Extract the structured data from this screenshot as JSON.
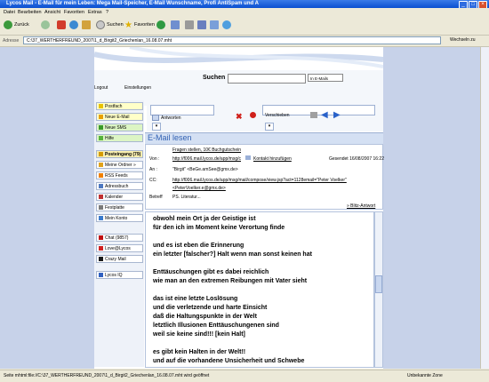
{
  "window": {
    "title": "Lycos Mail - E-Mail für mein Leben: Mega Mail-Speicher, E-Mail Wunschname, Profi AntiSpam und A"
  },
  "menu": [
    "Datei",
    "Bearbeiten",
    "Ansicht",
    "Favoriten",
    "Extras",
    "?"
  ],
  "toolbar": {
    "back": "Zurück",
    "search": "Suchen",
    "favorites": "Favoriten"
  },
  "address": {
    "label": "Adresse",
    "value": "C:\\37_WERTHERFREUND_2007\\1_d_Birgit2_Griechenlan_16.08.07.mht",
    "go": "Wechseln zu"
  },
  "header": {
    "search_label": "Suchen",
    "select_value": "In E-Mails",
    "logout": "Logout",
    "settings": "Einstellungen"
  },
  "sidebar": [
    {
      "label": "Postfach",
      "style": "y",
      "icon": "#e8c200"
    },
    {
      "label": "Neue E-Mail",
      "style": "y",
      "icon": "#e8a000"
    },
    {
      "label": "Neue SMS",
      "style": "g",
      "icon": "#3a9a2a"
    },
    {
      "label": "Hilfe",
      "style": "g",
      "icon": "#57b33c"
    },
    {
      "label": "Posteingang (79)",
      "style": "s",
      "icon": "#d49b00"
    },
    {
      "label": "Meine Ordner »",
      "style": "n",
      "icon": "#e0a21b"
    },
    {
      "label": "RSS Feeds",
      "style": "n",
      "icon": "#f08000"
    },
    {
      "label": "Adressbuch",
      "style": "n",
      "icon": "#4d78c0"
    },
    {
      "label": "Kalender",
      "style": "n",
      "icon": "#c03030"
    },
    {
      "label": "Festplatte",
      "style": "n",
      "icon": "#7a7a7a"
    },
    {
      "label": "Mein Konto",
      "style": "n",
      "icon": "#3a7acc"
    },
    {
      "label": "Chat (9857)",
      "style": "n",
      "icon": "#c01010"
    },
    {
      "label": "Love@Lycos",
      "style": "n",
      "icon": "#d02020"
    },
    {
      "label": "Crazy Mail",
      "style": "n",
      "icon": "#1a1a1a"
    },
    {
      "label": "Lycos IQ",
      "style": "n",
      "icon": "#3060c0"
    }
  ],
  "actions": {
    "reply": "Antworten",
    "move": "Verschieben"
  },
  "message": {
    "title": "E-Mail lesen",
    "subject_top": "Fragen stellen, 10€ Buchgutschein",
    "from_label": "Von :",
    "from_value": "http://f006.mail.lycos.de/app/msg/c",
    "contact": "Kontakt hinzufügen",
    "sent": "Gesendet 16/08/2007 16:22",
    "to_label": "An :",
    "to_value": "\"Birgit\" <BeGe.amSee@gmx.de>",
    "cc_label": "CC:",
    "cc_value": "http://f006.mail.lycos.de/app/msg/mail/compose/view.jsp?act=1128email=\"Peter Voelker\"",
    "cc_value2": "<PeterVoelker.e@gmx.de>",
    "betreff_label": "Betreff",
    "betreff_value": "PS. Literatur...",
    "quick": "» Blitz-Antwort"
  },
  "body_lines": [
    "obwohl mein Ort ja der Geistige ist",
    "für den ich im Moment keine Verortung finde",
    "",
    "und es ist eben die Erinnerung",
    "ein letzter [falscher?] Halt wenn man sonst keinen hat",
    "",
    "Enttäuschungen gibt es dabei reichlich",
    "wie man an den extremen Reibungen mit Vater sieht",
    "",
    "das ist eine letzte Loslösung",
    "und die verletzende und harte Einsicht",
    "daß die Haltungspunkte in der Welt",
    "letztlich Illusionen Enttäuschungenen sind",
    "weil sie keine sind!!!  [kein Halt]",
    "",
    "es gibt kein Halten in der Welt!!",
    "und auf die vorhandene Unsicherheit und Schwebe"
  ],
  "status": {
    "left": "Seite mhtml:file://C:\\37_WERTHERFREUND_2007\\1_d_Birgit2_Griechenlan_16.08.07.mht wird geöffnet",
    "zone": "Unbekannte Zone"
  }
}
